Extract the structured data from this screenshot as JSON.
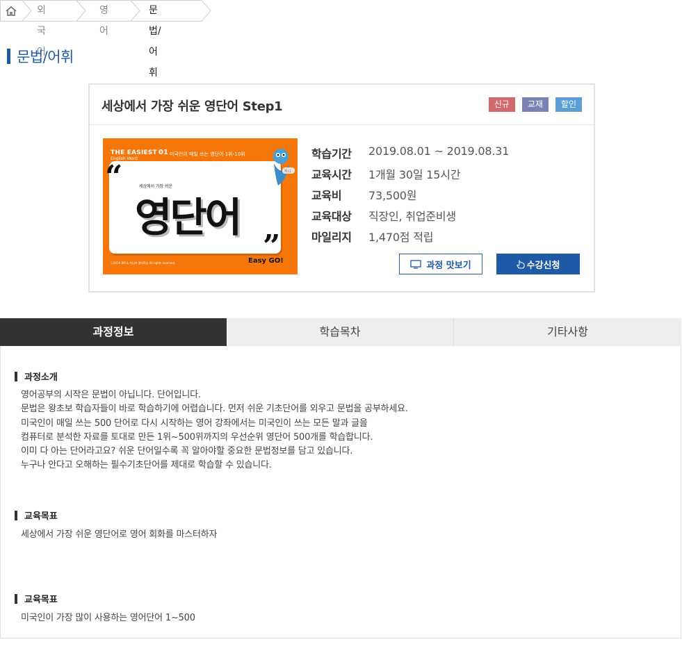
{
  "breadcrumb": {
    "home_icon": "home-icon",
    "items": [
      "외국어",
      "영어",
      "문법/어휘"
    ]
  },
  "page_title": "문법/어휘",
  "course": {
    "title": "세상에서 가장 쉬운 영단어 Step1",
    "badges": [
      "신규",
      "교재",
      "할인"
    ],
    "thumbnail": {
      "series": "THE EASIEST",
      "series_sub": "English Word",
      "number": "01",
      "tagline": "미국인이 매일 쓰는 영단어 1위-10위",
      "small_title": "세상에서 가장 쉬운",
      "big_title": "영단어",
      "open_quote": "“",
      "close_quote": "”",
      "easy": "Easy GO!",
      "copyright": "ⓒ2019 BM & 지니어 영어학습 All rights reserved."
    },
    "info": [
      {
        "label": "학습기간",
        "value": "2019.08.01 ~ 2019.08.31"
      },
      {
        "label": "교육시간",
        "value": "1개월 30일 15시간"
      },
      {
        "label": "교육비",
        "value": "73,500원"
      },
      {
        "label": "교육대상",
        "value": "직장인, 취업준비생"
      },
      {
        "label": "마일리지",
        "value": "1,470점 적립"
      }
    ],
    "preview_button": "과정 맛보기",
    "apply_button": "수강신청"
  },
  "tabs": [
    "과정정보",
    "학습목차",
    "기타사항"
  ],
  "sections": [
    {
      "heading": "과정소개",
      "lines": [
        "영어공부의 시작은 문법이 아닙니다. 단어입니다.",
        "문법은 왕초보 학습자들이 바로 학습하기에 어렵습니다. 먼저 쉬운 기초단어를 외우고 문법을 공부하세요.",
        "미국인이 매일 쓰는 500 단어로 다시 시작하는 영어 강좌에서는 미국인이 쓰는 모든 말과 글을",
        "컴퓨터로 분석한 자료를 토대로 만든 1위~500위까지의 우선순위 영단어 500개를 학습합니다.",
        "이미 다 아는 단어라고요? 쉬운 단어일수록 꼭 알아야할 중요한 문법정보를 담고 있습니다.",
        "누구나 안다고 오해하는 필수기초단어를 제대로 학습할 수 있습니다."
      ]
    },
    {
      "heading": "교육목표",
      "lines": [
        "세상에서 가장 쉬운 영단어로 영어 회화를 마스터하자"
      ]
    },
    {
      "heading": "교육목표",
      "lines": [
        "미국인이 가장 많이 사용하는 영어단어 1~500"
      ]
    }
  ],
  "colors": {
    "brand_blue": "#1f5aa7",
    "badge_new": "#d0686c",
    "badge_book": "#7982b0",
    "badge_sale": "#5b9fd6",
    "thumb_orange": "#f6760a"
  }
}
